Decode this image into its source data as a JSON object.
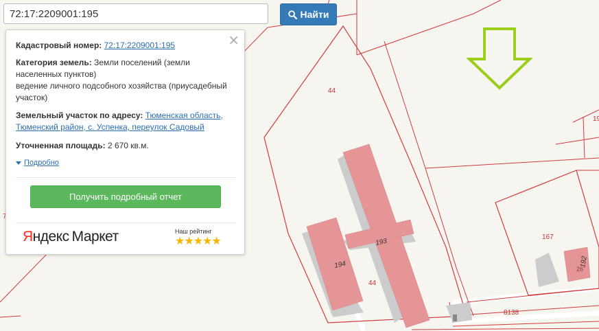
{
  "search": {
    "value": "72:17:2209001:195",
    "button_label": "Найти",
    "icon": "search-icon"
  },
  "popup": {
    "cadastral_label": "Кадастровый номер:",
    "cadastral_value": "72:17:2209001:195",
    "category_label": "Категория земель:",
    "category_value_line1": "Земли поселений (земли",
    "category_value_line2": "населенных пунктов)",
    "usage_line1": "ведение личного подсобного хозяйства (приусадебный",
    "usage_line2": "участок)",
    "address_label": "Земельный участок по адресу:",
    "address_line1": "Тюменская область,",
    "address_line2": "Тюменский район, с. Успенка, переулок Садовый",
    "area_label": "Уточненная площадь:",
    "area_value": "2 670 кв.м.",
    "details_label": "Подробно",
    "report_button": "Получить подробный отчет",
    "close_icon": "close-icon"
  },
  "yandex": {
    "logo_part1": "Яндекс",
    "logo_part2": "Маркет",
    "rating_label": "Наш рейтинг",
    "stars": "★★★★★",
    "star_count": 5
  },
  "map": {
    "labels": {
      "parcel_44_top": "44",
      "parcel_44_bottom": "44",
      "building_193": "193",
      "building_194": "194",
      "parcel_167": "167",
      "building_192": "192",
      "building_26": "26",
      "road_8138": "8138",
      "edge_19": "19",
      "edge_7": "7"
    },
    "colors": {
      "background": "#f6f5f0",
      "parcel_line": "#d23b3b",
      "building": "#e69596",
      "shadow": "#c7c7c7",
      "arrow": "#9ace1a"
    }
  }
}
